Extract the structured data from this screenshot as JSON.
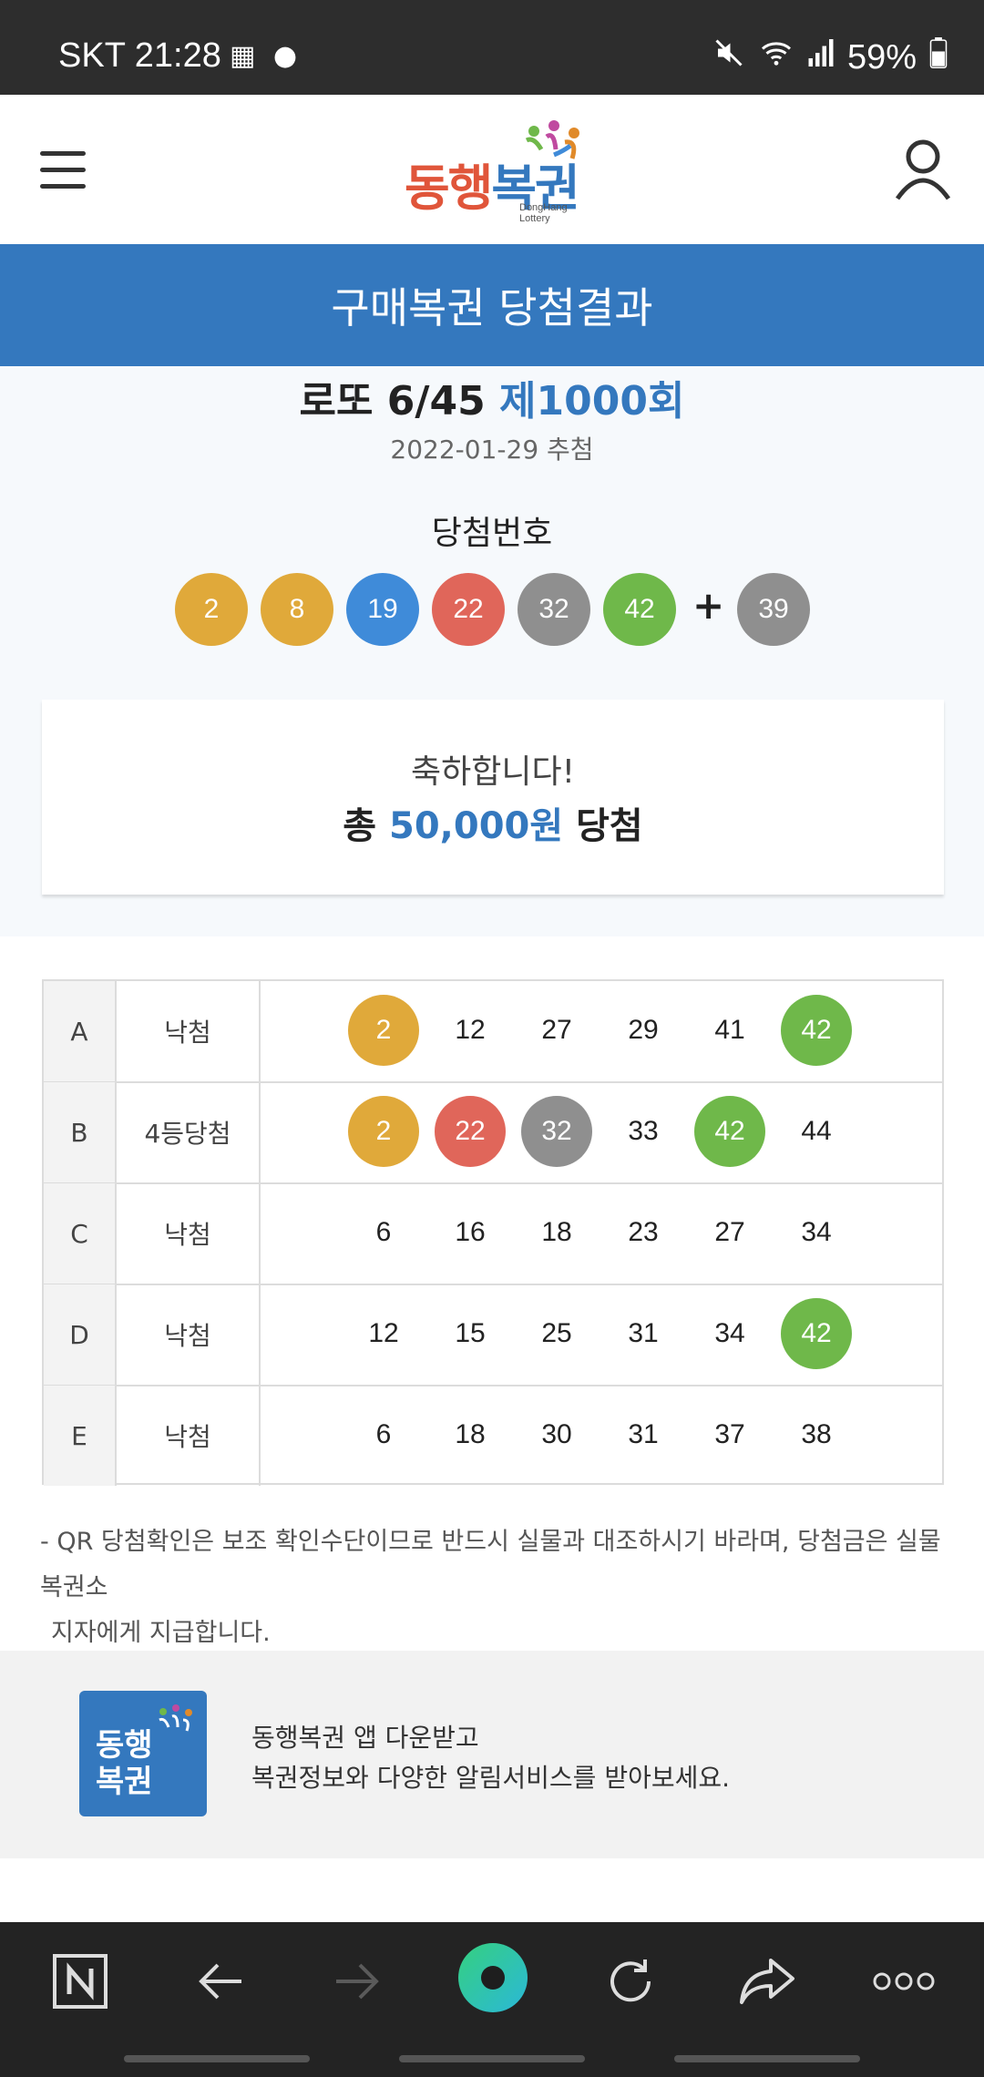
{
  "status_bar": {
    "carrier_time": "SKT 21:28",
    "battery": "59%",
    "icons": [
      "qr-code-icon",
      "chat-bubble-icon",
      "mute-icon",
      "wifi-icon",
      "signal-icon",
      "battery-icon"
    ]
  },
  "header": {
    "logo_text": "동행복권",
    "logo_sub": "DongHang Lottery",
    "icons": [
      "hamburger-menu-icon",
      "user-icon"
    ]
  },
  "page_title": "구매복권 당첨결과",
  "draw": {
    "game": "로또 6/45",
    "round": "제1000회",
    "date": "2022-01-29 추첨",
    "winning_label": "당첨번호",
    "numbers": [
      "2",
      "8",
      "19",
      "22",
      "32",
      "42"
    ],
    "plus": "+",
    "bonus": "39"
  },
  "result": {
    "congrats": "축하합니다!",
    "total_prefix": "총",
    "amount": "50,000원",
    "total_suffix": "당첨"
  },
  "tickets": [
    {
      "id": "A",
      "result": "낙첨",
      "numbers": [
        "2",
        "12",
        "27",
        "29",
        "41",
        "42"
      ]
    },
    {
      "id": "B",
      "result": "4등당첨",
      "numbers": [
        "2",
        "22",
        "32",
        "33",
        "42",
        "44"
      ]
    },
    {
      "id": "C",
      "result": "낙첨",
      "numbers": [
        "6",
        "16",
        "18",
        "23",
        "27",
        "34"
      ]
    },
    {
      "id": "D",
      "result": "낙첨",
      "numbers": [
        "12",
        "15",
        "25",
        "31",
        "34",
        "42"
      ]
    },
    {
      "id": "E",
      "result": "낙첨",
      "numbers": [
        "6",
        "18",
        "30",
        "31",
        "37",
        "38"
      ]
    }
  ],
  "notice_line1": "- QR 당첨확인은 보조 확인수단이므로 반드시 실물과 대조하시기 바라며, 당첨금은 실물 복권소",
  "notice_line2": "지자에게 지급합니다.",
  "app_banner": {
    "logo_line1": "동행",
    "logo_line2": "복권",
    "text1": "동행복권 앱 다운받고",
    "text2": "복권정보와 다양한 알림서비스를 받아보세요."
  },
  "bottom_nav": {
    "icons": [
      "tab-n-icon",
      "back-arrow-icon",
      "forward-arrow-icon",
      "home-green-icon",
      "refresh-icon",
      "share-icon",
      "more-dots-icon"
    ]
  },
  "colors": {
    "ball_1_10": "#e0a93a",
    "ball_11_20": "#3f8bd9",
    "ball_21_30": "#e0665a",
    "ball_31_40": "#8f8f8f",
    "ball_41_45": "#6fb84a",
    "accent": "#3478be"
  }
}
